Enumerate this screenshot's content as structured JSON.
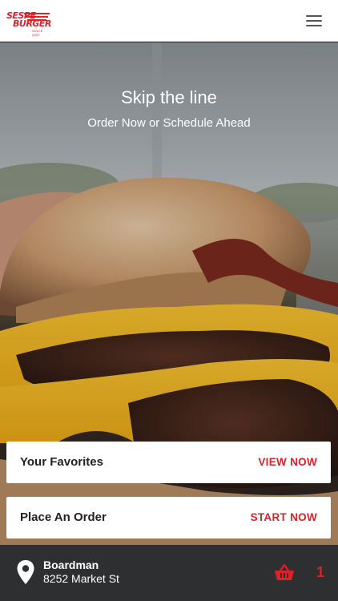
{
  "header": {
    "logo_line1": "SESPE",
    "logo_line2": "BURGER",
    "logo_tag": "SINCE 2007",
    "menu_icon": "hamburger-menu-icon"
  },
  "hero": {
    "title": "Skip the line",
    "subtitle": "Order Now or Schedule Ahead"
  },
  "cards": [
    {
      "title": "Your Favorites",
      "action": "VIEW NOW"
    },
    {
      "title": "Place An Order",
      "action": "START NOW"
    }
  ],
  "footer": {
    "location_icon": "map-pin-icon",
    "location_name": "Boardman",
    "location_address": "8252 Market St",
    "cart_icon": "shopping-basket-icon",
    "cart_count": "1"
  },
  "colors": {
    "accent": "#e11f26",
    "footer_bg": "#2e2f31",
    "header_bg": "#ffffff"
  }
}
